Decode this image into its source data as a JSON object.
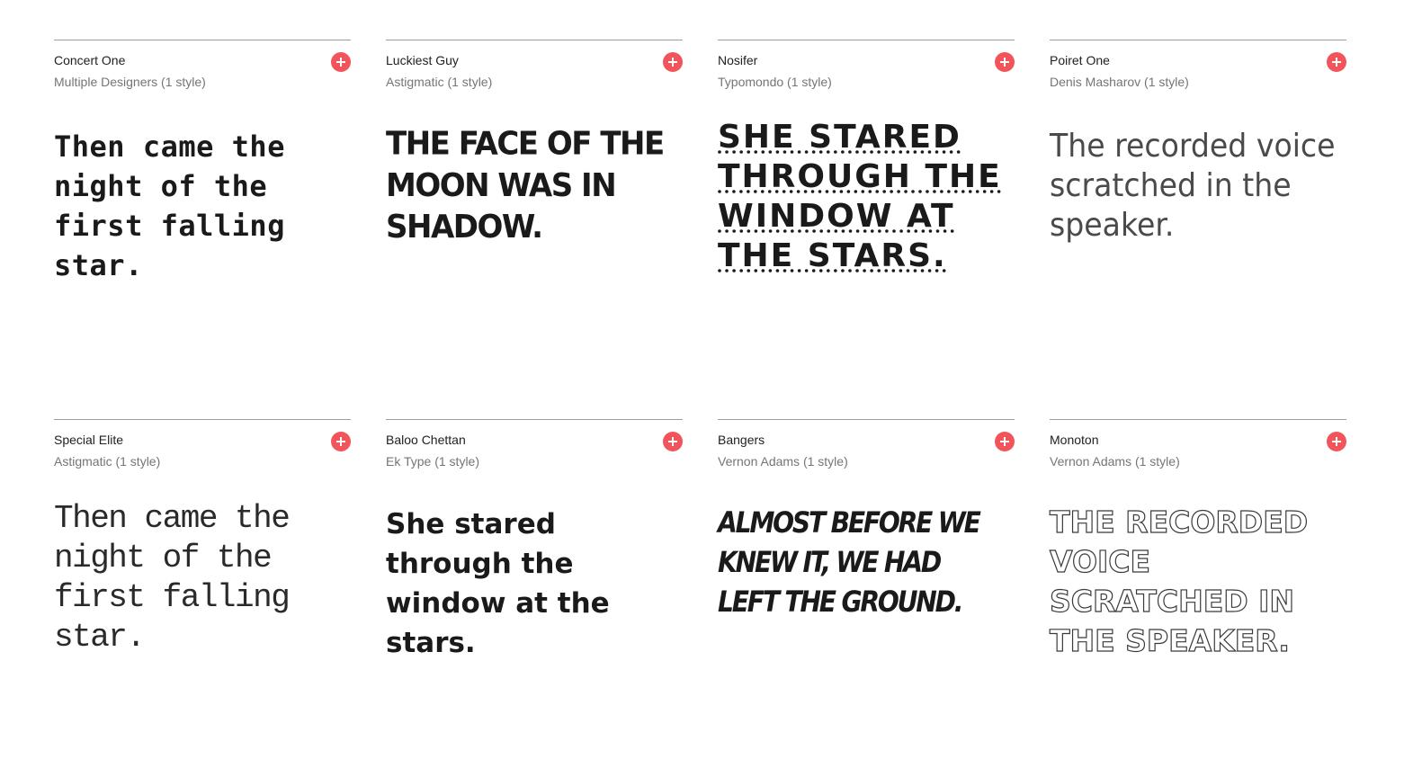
{
  "accent_color": "#f2545b",
  "fonts": [
    {
      "name": "Concert One",
      "designer": "Multiple Designers (1 style)",
      "sample": "Then came the night of the first falling star.",
      "add_icon": "plus-icon"
    },
    {
      "name": "Luckiest Guy",
      "designer": "Astigmatic (1 style)",
      "sample": "The face of the moon was in shadow.",
      "add_icon": "plus-icon"
    },
    {
      "name": "Nosifer",
      "designer": "Typomondo (1 style)",
      "sample": "She stared through the window at the stars.",
      "add_icon": "plus-icon"
    },
    {
      "name": "Poiret One",
      "designer": "Denis Masharov (1 style)",
      "sample": "The recorded voice scratched in the speaker.",
      "add_icon": "plus-icon"
    },
    {
      "name": "Special Elite",
      "designer": "Astigmatic (1 style)",
      "sample": "Then came the night of the first falling star.",
      "add_icon": "plus-icon"
    },
    {
      "name": "Baloo Chettan",
      "designer": "Ek Type (1 style)",
      "sample": "She stared through the window at the stars.",
      "add_icon": "plus-icon"
    },
    {
      "name": "Bangers",
      "designer": "Vernon Adams (1 style)",
      "sample": "Almost before we knew it, we had left the ground.",
      "add_icon": "plus-icon"
    },
    {
      "name": "Monoton",
      "designer": "Vernon Adams (1 style)",
      "sample": "The recorded voice scratched in the speaker.",
      "add_icon": "plus-icon"
    }
  ]
}
